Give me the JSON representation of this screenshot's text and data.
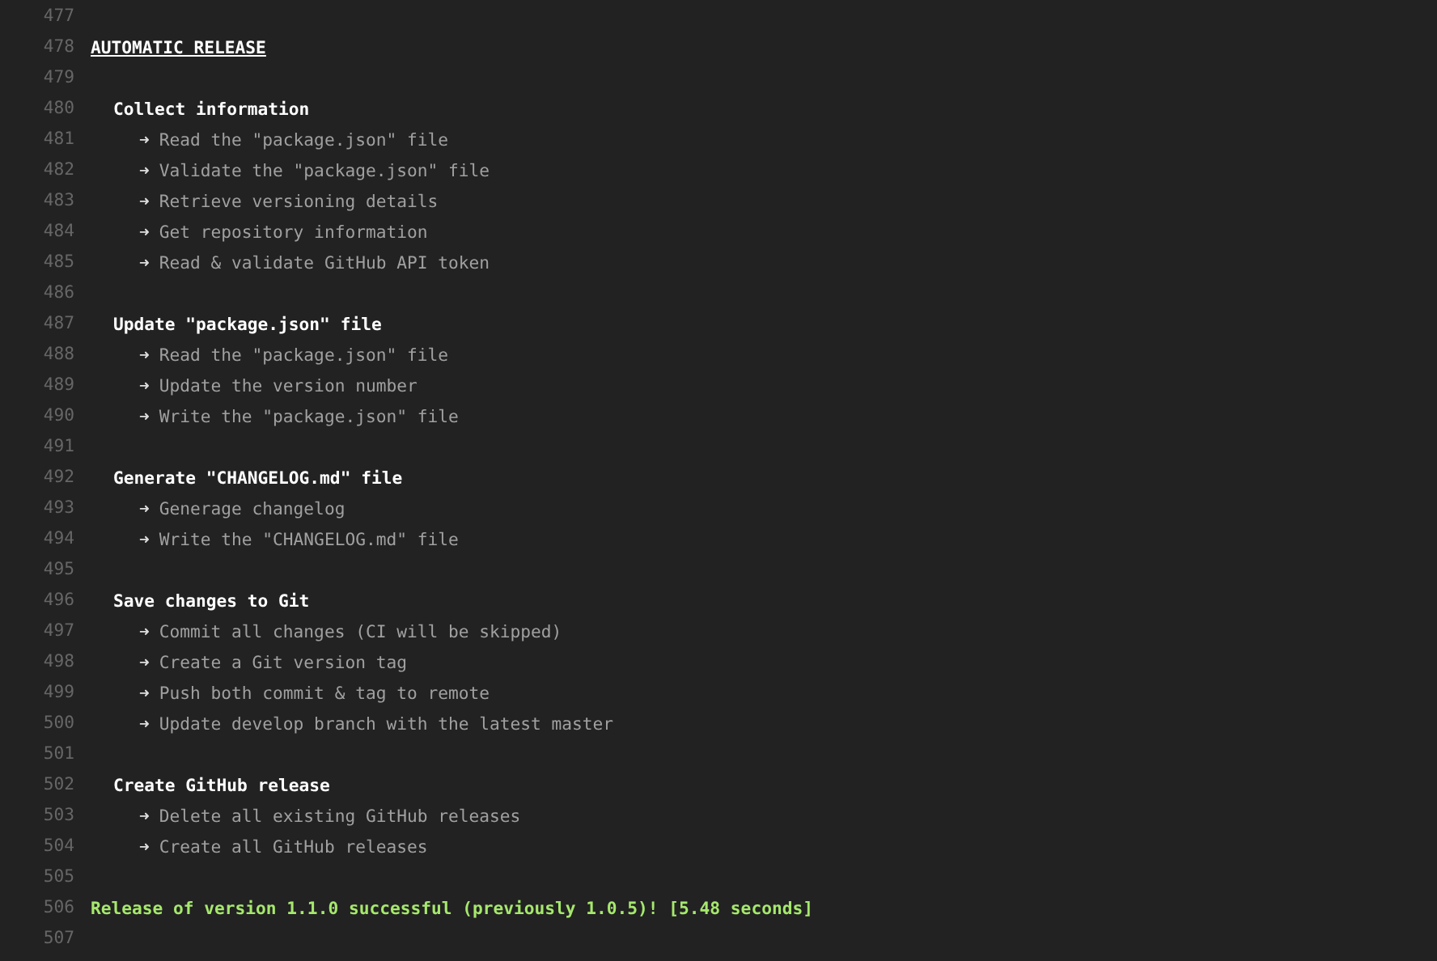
{
  "lines": [
    {
      "number": "477",
      "kind": "blank"
    },
    {
      "number": "478",
      "kind": "title",
      "text": "AUTOMATIC RELEASE"
    },
    {
      "number": "479",
      "kind": "blank"
    },
    {
      "number": "480",
      "kind": "heading",
      "text": "Collect information"
    },
    {
      "number": "481",
      "kind": "step",
      "arrow": "➜",
      "text": "Read the \"package.json\" file"
    },
    {
      "number": "482",
      "kind": "step",
      "arrow": "➜",
      "text": "Validate the \"package.json\" file"
    },
    {
      "number": "483",
      "kind": "step",
      "arrow": "➜",
      "text": "Retrieve versioning details"
    },
    {
      "number": "484",
      "kind": "step",
      "arrow": "➜",
      "text": "Get repository information"
    },
    {
      "number": "485",
      "kind": "step",
      "arrow": "➜",
      "text": "Read & validate GitHub API token"
    },
    {
      "number": "486",
      "kind": "blank"
    },
    {
      "number": "487",
      "kind": "heading",
      "text": "Update \"package.json\" file"
    },
    {
      "number": "488",
      "kind": "step",
      "arrow": "➜",
      "text": "Read the \"package.json\" file"
    },
    {
      "number": "489",
      "kind": "step",
      "arrow": "➜",
      "text": "Update the version number"
    },
    {
      "number": "490",
      "kind": "step",
      "arrow": "➜",
      "text": "Write the \"package.json\" file"
    },
    {
      "number": "491",
      "kind": "blank"
    },
    {
      "number": "492",
      "kind": "heading",
      "text": "Generate \"CHANGELOG.md\" file"
    },
    {
      "number": "493",
      "kind": "step",
      "arrow": "➜",
      "text": "Generage changelog"
    },
    {
      "number": "494",
      "kind": "step",
      "arrow": "➜",
      "text": "Write the \"CHANGELOG.md\" file"
    },
    {
      "number": "495",
      "kind": "blank"
    },
    {
      "number": "496",
      "kind": "heading",
      "text": "Save changes to Git"
    },
    {
      "number": "497",
      "kind": "step",
      "arrow": "➜",
      "text": "Commit all changes (CI will be skipped)"
    },
    {
      "number": "498",
      "kind": "step",
      "arrow": "➜",
      "text": "Create a Git version tag"
    },
    {
      "number": "499",
      "kind": "step",
      "arrow": "➜",
      "text": "Push both commit & tag to remote"
    },
    {
      "number": "500",
      "kind": "step",
      "arrow": "➜",
      "text": "Update develop branch with the latest master"
    },
    {
      "number": "501",
      "kind": "blank"
    },
    {
      "number": "502",
      "kind": "heading",
      "text": "Create GitHub release"
    },
    {
      "number": "503",
      "kind": "step",
      "arrow": "➜",
      "text": "Delete all existing GitHub releases"
    },
    {
      "number": "504",
      "kind": "step",
      "arrow": "➜",
      "text": "Create all GitHub releases"
    },
    {
      "number": "505",
      "kind": "blank"
    },
    {
      "number": "506",
      "kind": "success",
      "text": "Release of version 1.1.0 successful (previously 1.0.5)! [5.48 seconds]"
    },
    {
      "number": "507",
      "kind": "blank"
    }
  ]
}
